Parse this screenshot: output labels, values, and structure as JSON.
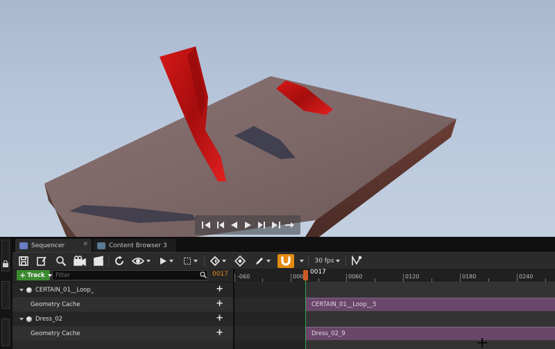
{
  "viewport": {
    "playback_controls": [
      "jump-to-start",
      "step-back",
      "play-reverse",
      "play",
      "step-forward",
      "jump-to-end",
      "loop"
    ]
  },
  "tabs": [
    {
      "label": "Sequencer",
      "icon": "sequencer-icon",
      "active": true
    },
    {
      "label": "Content Browser 3",
      "icon": "content-browser-icon",
      "active": false
    }
  ],
  "toolbar": {
    "fps_label": "30 fps",
    "accent_color": "#e58b12"
  },
  "tracks_panel": {
    "add_track_label": "Track",
    "filter_placeholder": "Filter",
    "frame_readout": "0017",
    "rows": [
      {
        "type": "actor",
        "label": "CERTAIN_01__Loop_"
      },
      {
        "type": "track",
        "label": "Geometry Cache"
      },
      {
        "type": "actor",
        "label": "Dress_02"
      },
      {
        "type": "track",
        "label": "Geometry Cache"
      }
    ]
  },
  "timeline": {
    "ticks": [
      "-060",
      "0000",
      "0060",
      "0120",
      "0180",
      "0240"
    ],
    "playhead_label": "0017",
    "sections": [
      {
        "label": "CERTAIN_01__Loop__5"
      },
      {
        "label": "Dress_02_9"
      }
    ],
    "section_color": "#6a476a",
    "playhead_color": "#cc5a24"
  }
}
